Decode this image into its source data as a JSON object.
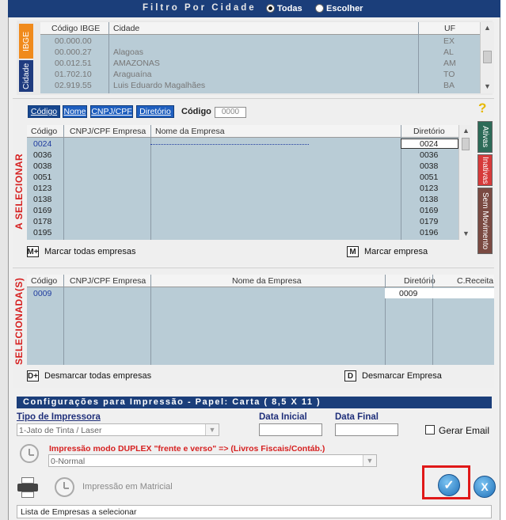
{
  "filter": {
    "title": "Filtro Por Cidade",
    "options": [
      {
        "label": "Todas",
        "selected": true
      },
      {
        "label": "Escolher",
        "selected": false
      }
    ]
  },
  "ibge": {
    "tabs": [
      "IBGE",
      "Cidade"
    ],
    "headers": [
      "Código IBGE",
      "Cidade",
      "UF"
    ],
    "rows": [
      {
        "code": "00.000.00",
        "city": "",
        "uf": "EX"
      },
      {
        "code": "00.000.27",
        "city": "Alagoas",
        "uf": "AL"
      },
      {
        "code": "00.012.51",
        "city": "AMAZONAS",
        "uf": "AM"
      },
      {
        "code": "01.702.10",
        "city": "Araguaína",
        "uf": "TO"
      },
      {
        "code": "02.919.55",
        "city": "Luis Eduardo Magalhães",
        "uf": "BA"
      }
    ]
  },
  "select": {
    "side_label": "A SELECIONAR",
    "search_tabs": [
      "Código",
      "Nome",
      "CNPJ/CPF",
      "Diretório"
    ],
    "search_label": "Código",
    "search_value": "0000",
    "help": "?",
    "headers": [
      "Código",
      "CNPJ/CPF Empresa",
      "Nome da Empresa",
      "Diretório"
    ],
    "rows": [
      {
        "code": "0024",
        "dir": "0024"
      },
      {
        "code": "0036",
        "dir": "0036"
      },
      {
        "code": "0038",
        "dir": "0038"
      },
      {
        "code": "0051",
        "dir": "0051"
      },
      {
        "code": "0123",
        "dir": "0123"
      },
      {
        "code": "0138",
        "dir": "0138"
      },
      {
        "code": "0169",
        "dir": "0169"
      },
      {
        "code": "0178",
        "dir": "0179"
      },
      {
        "code": "0195",
        "dir": "0196"
      }
    ],
    "status_tabs": [
      "Ativas",
      "Inativas",
      "Sem Movimento"
    ],
    "mark_all": {
      "key": "M+",
      "label": "Marcar todas empresas"
    },
    "mark_one": {
      "key": "M",
      "label": "Marcar empresa"
    }
  },
  "selected": {
    "side_label": "SELECIONADA(S)",
    "headers": [
      "Código",
      "CNPJ/CPF Empresa",
      "Nome da Empresa",
      "Diretório",
      "C.Receita"
    ],
    "rows": [
      {
        "code": "0009",
        "dir": "0009"
      }
    ],
    "unmark_all": {
      "key": "D+",
      "label": "Desmarcar todas empresas"
    },
    "unmark_one": {
      "key": "D",
      "label": "Desmarcar Empresa"
    }
  },
  "config": {
    "title": "Configurações para Impressão - Papel: Carta ( 8,5 X 11 )",
    "printer_label": "Tipo de Impressora",
    "printer_value": "1-Jato de Tinta / Laser",
    "start_label": "Data Inicial",
    "end_label": "Data Final",
    "email_label": "Gerar Email",
    "duplex_label": "Impressão modo DUPLEX \"frente e verso\" => (Livros Fiscais/Contáb.)",
    "duplex_value": "0-Normal",
    "matrix_label": "Impressão em Matricial"
  },
  "status_bar": "Lista de Empresas a selecionar",
  "colors": {
    "accent": "#1f5fbf",
    "panel": "#b9ccd6",
    "header": "#1b3e7a",
    "danger": "#d62020",
    "ok": "#2b82c9"
  }
}
